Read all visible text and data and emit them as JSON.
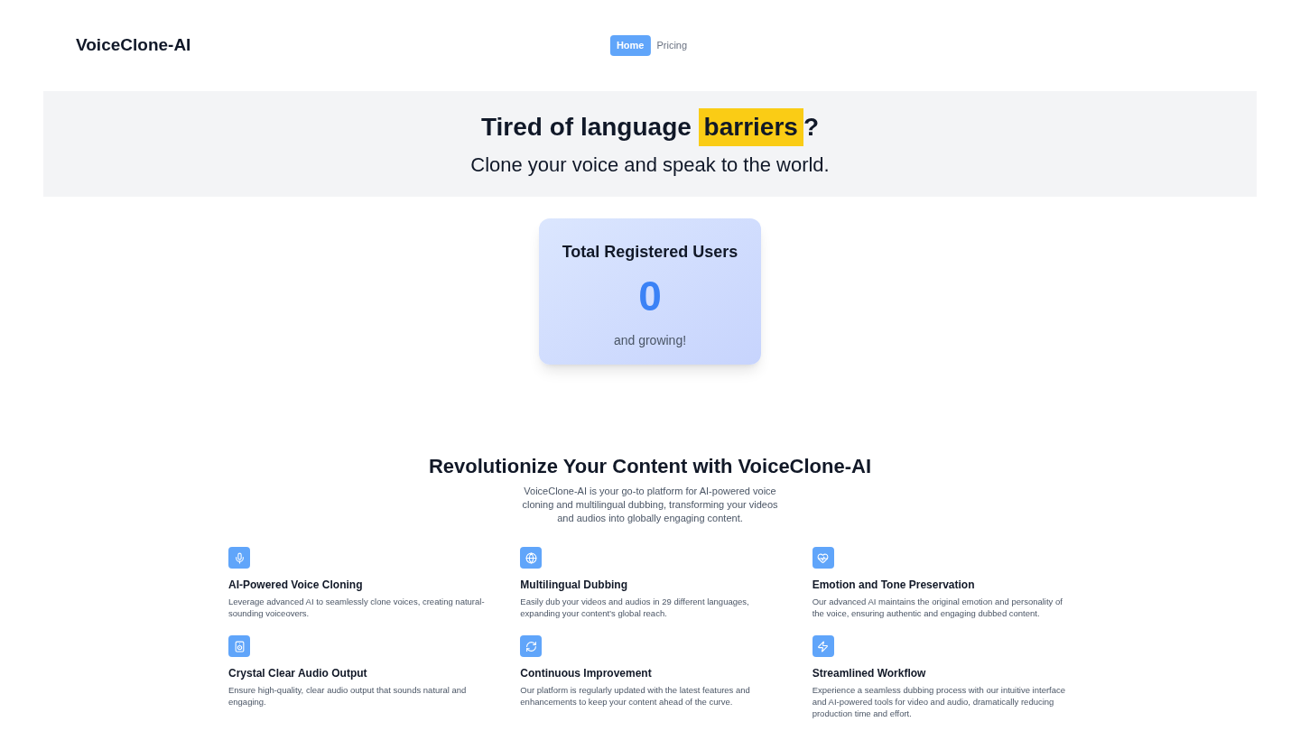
{
  "brand": "VoiceClone-AI",
  "nav": [
    {
      "label": "Home",
      "selected": true
    },
    {
      "label": "Pricing",
      "selected": false
    }
  ],
  "hero": {
    "title_before": "Tired of language",
    "highlight": "barriers",
    "title_after": "?",
    "subtitle": "Clone your voice and speak to the world."
  },
  "stats_card": {
    "title": "Total Registered Users",
    "value": "0",
    "caption": "and growing!"
  },
  "section": {
    "title": "Revolutionize Your Content with VoiceClone-AI",
    "intro": "VoiceClone-AI is your go-to platform for AI-powered voice cloning and multilingual dubbing, transforming your videos and audios into globally engaging content."
  },
  "features": [
    {
      "title": "AI-Powered Voice Cloning",
      "text": "Leverage advanced AI to seamlessly clone voices, creating natural-sounding voiceovers."
    },
    {
      "title": "Multilingual Dubbing",
      "text": "Easily dub your videos and audios in 29 different languages, expanding your content’s global reach."
    },
    {
      "title": "Emotion and Tone Preservation",
      "text": "Our advanced AI maintains the original emotion and personality of the voice, ensuring authentic and engaging dubbed content."
    },
    {
      "title": "Crystal Clear Audio Output",
      "text": "Ensure high-quality, clear audio output that sounds natural and engaging."
    },
    {
      "title": "Continuous Improvement",
      "text": "Our platform is regularly updated with the latest features and enhancements to keep your content ahead of the curve."
    },
    {
      "title": "Streamlined Workflow",
      "text": "Experience a seamless dubbing process with our intuitive interface and AI-powered tools for video and audio, dramatically reducing production time and effort."
    }
  ]
}
